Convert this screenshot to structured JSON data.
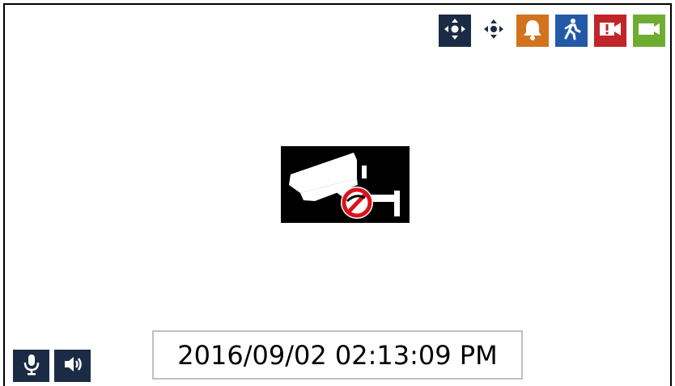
{
  "toolbar": {
    "buttons": [
      {
        "icon": "ptz-move-icon",
        "bg": "#1b2b45"
      },
      {
        "icon": "ptz-arrows-icon",
        "bg": "#ffffff"
      },
      {
        "icon": "bell-icon",
        "bg": "#d2731f"
      },
      {
        "icon": "motion-person-icon",
        "bg": "#2459a8"
      },
      {
        "icon": "record-alarm-icon",
        "bg": "#c0252a"
      },
      {
        "icon": "video-camera-icon",
        "bg": "#6fac32"
      }
    ]
  },
  "video": {
    "state_icon": "no-camera-signal-icon",
    "accent": "#d7141b"
  },
  "bottom_controls": {
    "buttons": [
      {
        "icon": "microphone-icon",
        "bg": "#1b2b45"
      },
      {
        "icon": "speaker-icon",
        "bg": "#1b2b45"
      }
    ]
  },
  "timestamp": {
    "text": "2016/09/02 02:13:09 PM"
  }
}
